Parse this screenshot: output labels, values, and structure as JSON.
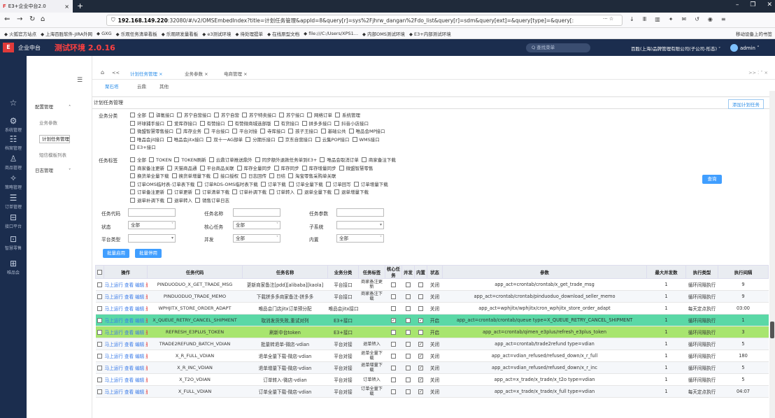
{
  "browser": {
    "tab_title": "E3+企业中台2.0",
    "url_prefix": "192.168.149.220",
    "url_rest": ":32080/#/v2/OMSEmbedIndex?title=计划任务管理&appId=8&query[r]=sys%2Fjhrw_dangan%2Fdo_list&query[r]=sdm&query[ext]=&query[type]=&query[:",
    "url_more": "··· ☆",
    "bookmarks": [
      "火狐官方站点",
      "上海百胜软件-JIRA外网",
      "GXG",
      "乐观任务清单看板",
      "乐观研发量看板",
      "e3测试环境",
      "待处理提单",
      "在线原型文档",
      "file:///C:/Users/XPS1...",
      "内部OMS测试环境",
      "E3+内部测试环境"
    ],
    "bookmarks_right": "移动设备上的书签"
  },
  "app": {
    "logo": "E",
    "name": "企业中台",
    "env": "测试环境 2.0.16",
    "search_placeholder": "Q 查找菜单",
    "company": "百胜(上海)品牌管理有限公司(子公司-形态) ˅",
    "user": "admin ˅"
  },
  "rail": [
    {
      "icon": "☆",
      "label": ""
    },
    {
      "icon": "⚙",
      "label": "系统管理"
    },
    {
      "icon": "☷",
      "label": "档案管理"
    },
    {
      "icon": "♙",
      "label": "商品管理"
    },
    {
      "icon": "✧",
      "label": "策略管理"
    },
    {
      "icon": "☰",
      "label": "订单管理"
    },
    {
      "icon": "⊟",
      "label": "接口平台"
    },
    {
      "icon": "⊡",
      "label": "智慧零售"
    },
    {
      "icon": "⊞",
      "label": "唯品会"
    }
  ],
  "menu2": {
    "collapse": "☰",
    "group": "配置管理",
    "items": [
      "业务参数",
      "计划任务管理",
      "短信模板列表"
    ],
    "group2": "日志管理"
  },
  "tabs": {
    "home": "⌂",
    "nav": "<<",
    "items": [
      "计划任务管理",
      "业务参数",
      "电商管理"
    ],
    "right": ">>  ⁚  ˅  ×",
    "sub": [
      "聚石塔",
      "云鼎",
      "其他"
    ]
  },
  "page": {
    "title": "计划任务管理",
    "add_button": "添加计划任务"
  },
  "filters": {
    "biz_label": "业务分类",
    "biz_rows": [
      [
        "全部",
        "驿氪接口",
        "苏宁自营接口",
        "苏宁自营",
        "苏宁特卖接口",
        "苏宁接口",
        "网络订单",
        "系统管理"
      ],
      [
        "环球捕手接口",
        "爱库存接口",
        "有赞接口",
        "有赞微商城选部版",
        "有货接口",
        "拼多多接口",
        "抖音小店接口"
      ],
      [
        "微盟智慧零售接口",
        "库存业务",
        "平台接口",
        "平台对接",
        "寺库接口",
        "孩子王接口",
        "基础公共",
        "唯品会MP接口"
      ],
      [
        "唯品会jit接口",
        "唯品会jitx接口",
        "双十一AG部单",
        "分期乐接口",
        "京东自营接口",
        "云集POP接口",
        "WMS接口"
      ],
      [
        "E3+接口"
      ]
    ],
    "tag_label": "任务标签",
    "tag_rows": [
      [
        "全部",
        "TOKEN",
        "TOKEN刷新",
        "云鼎订单推送鼎外",
        "同步额外退款任务单到E3+",
        "唯品会取消订单",
        "商家备注下载"
      ],
      [
        "商家备注更新",
        "天猫商品通",
        "平台商品关联",
        "库存全量同步",
        "库存同步",
        "库存增量同步",
        "微盟智慧零售"
      ],
      [
        "换货单全量下载",
        "换货单增量下载",
        "接口授权",
        "日志回传",
        "日结",
        "淘宝零售采购单关联"
      ],
      [
        "订单OMS临时表-订单表下载",
        "订单RDS-OMS临时表下载",
        "订单下载",
        "订单全量下载",
        "订单回写",
        "订单增量下载"
      ],
      [
        "订单备注更新",
        "订单更新",
        "订单清单下载",
        "订单补调下载",
        "订单转入",
        "退单全量下载",
        "退单增量下载"
      ],
      [
        "退单补调下载",
        "退单转入",
        "销售订单日志"
      ]
    ],
    "code_label": "任务代码",
    "name_label": "任务名称",
    "param_label": "任务参数",
    "status_label": "状态",
    "status_value": "全部",
    "core_label": "核心任务",
    "core_value": "全部",
    "subsys_label": "子系统",
    "subsys_value": "",
    "platform_label": "平台类型",
    "platform_value": "",
    "concurrent_label": "并发",
    "concurrent_value": "全部",
    "builtin_label": "内置",
    "builtin_value": "全部",
    "query_button": "查询",
    "batch_enable": "批量启用",
    "batch_disable": "批量停用"
  },
  "table": {
    "headers": [
      "",
      "操作",
      "任务代码",
      "任务名称",
      "业务分类",
      "任务标签",
      "核心任务",
      "并发",
      "内置",
      "状态",
      "参数",
      "最大并发数",
      "执行类型",
      "执行间隔"
    ],
    "ops": [
      "马上运行",
      "查看",
      "编辑",
      "删除"
    ],
    "rows": [
      {
        "code": "PINDUODUO_X_GET_TRADE_MSG",
        "name": "更新商家备注[pdd][alibaba][kaola]",
        "biz": "平台接口",
        "tag": "商家备注更新",
        "core": false,
        "conc": false,
        "builtin": false,
        "status": "关闭",
        "param": "app_act=crontab/crontab/x_get_trade_msg",
        "max": "1",
        "etype": "循环间隔执行",
        "interval": "9"
      },
      {
        "code": "PINDUODUO_TRADE_MEMO",
        "name": "下载拼多多商家备注-拼多多",
        "biz": "平台接口",
        "tag": "商家备注下载",
        "core": false,
        "conc": false,
        "builtin": false,
        "status": "关闭",
        "param": "app_act=crontab/crontab/pinduoduo_download_seller_memo",
        "max": "1",
        "etype": "循环间隔执行",
        "interval": "9"
      },
      {
        "code": "WPHJITX_STORE_ORDER_ADAPT",
        "name": "唯品会门店jitx订单预分配",
        "biz": "唯品会jitx接口",
        "tag": "",
        "core": false,
        "conc": false,
        "builtin": false,
        "status": "关闭",
        "param": "app_act=wphjitx/wphjitx/cron_wphjitx_store_order_adapt",
        "max": "1",
        "etype": "每天定点执行",
        "interval": "03:00"
      },
      {
        "code": "X_QUEUE_RETRY_CANCEL_SHIPMENT",
        "name": "取消发货失败,重试对列",
        "biz": "E3+接口",
        "tag": "",
        "core": true,
        "conc": false,
        "builtin": true,
        "status": "开启",
        "param": "app_act=crontab/crontab/queue type=X_QUEUE_RETRY_CANCEL_SHIPMENT",
        "max": "1",
        "etype": "循环间隔执行",
        "interval": "1"
      },
      {
        "code": "REFRESH_E3PLUS_TOKEN",
        "name": "刷新中台token",
        "biz": "E3+接口",
        "tag": "",
        "core": false,
        "conc": false,
        "builtin": false,
        "status": "开启",
        "param": "app_act=crontab/qimen_e3plus/refresh_e3plus_token",
        "max": "1",
        "etype": "循环间隔执行",
        "interval": "3"
      },
      {
        "code": "TRADE2REFUND_BATCH_VDIAN",
        "name": "批量转退单-微店-vdian",
        "biz": "平台对接",
        "tag": "退单转入",
        "core": false,
        "conc": false,
        "builtin": true,
        "status": "关闭",
        "param": "app_act=crontab/trade2refund type=vdian",
        "max": "1",
        "etype": "循环间隔执行",
        "interval": "5"
      },
      {
        "code": "X_R_FULL_VDIAN",
        "name": "退单全量下载-微店-vdian",
        "biz": "平台对接",
        "tag": "退单全量下载",
        "core": false,
        "conc": false,
        "builtin": true,
        "status": "关闭",
        "param": "app_act=vdian_refused/refused_down/x_r_full",
        "max": "1",
        "etype": "循环间隔执行",
        "interval": "180"
      },
      {
        "code": "X_R_INC_VDIAN",
        "name": "退单增量下载-微店-vdian",
        "biz": "平台对接",
        "tag": "退单增量下载",
        "core": false,
        "conc": false,
        "builtin": true,
        "status": "关闭",
        "param": "app_act=vdian_refused/refused_down/x_r_inc",
        "max": "1",
        "etype": "循环间隔执行",
        "interval": "5"
      },
      {
        "code": "X_T2O_VDIAN",
        "name": "订单转入-微店-vdian",
        "biz": "平台对接",
        "tag": "订单转入",
        "core": false,
        "conc": false,
        "builtin": true,
        "status": "关闭",
        "param": "app_act=x_trade/x_trade/x_t2o type=vdian",
        "max": "1",
        "etype": "循环间隔执行",
        "interval": "5"
      },
      {
        "code": "X_FULL_VDIAN",
        "name": "订单全量下载-微店-vdian",
        "biz": "平台对接",
        "tag": "订单全量下载",
        "core": false,
        "conc": false,
        "builtin": true,
        "status": "关闭",
        "param": "app_act=x_trade/x_trade/x_full type=vdian",
        "max": "1",
        "etype": "每天定点执行",
        "interval": "04:07"
      }
    ]
  }
}
